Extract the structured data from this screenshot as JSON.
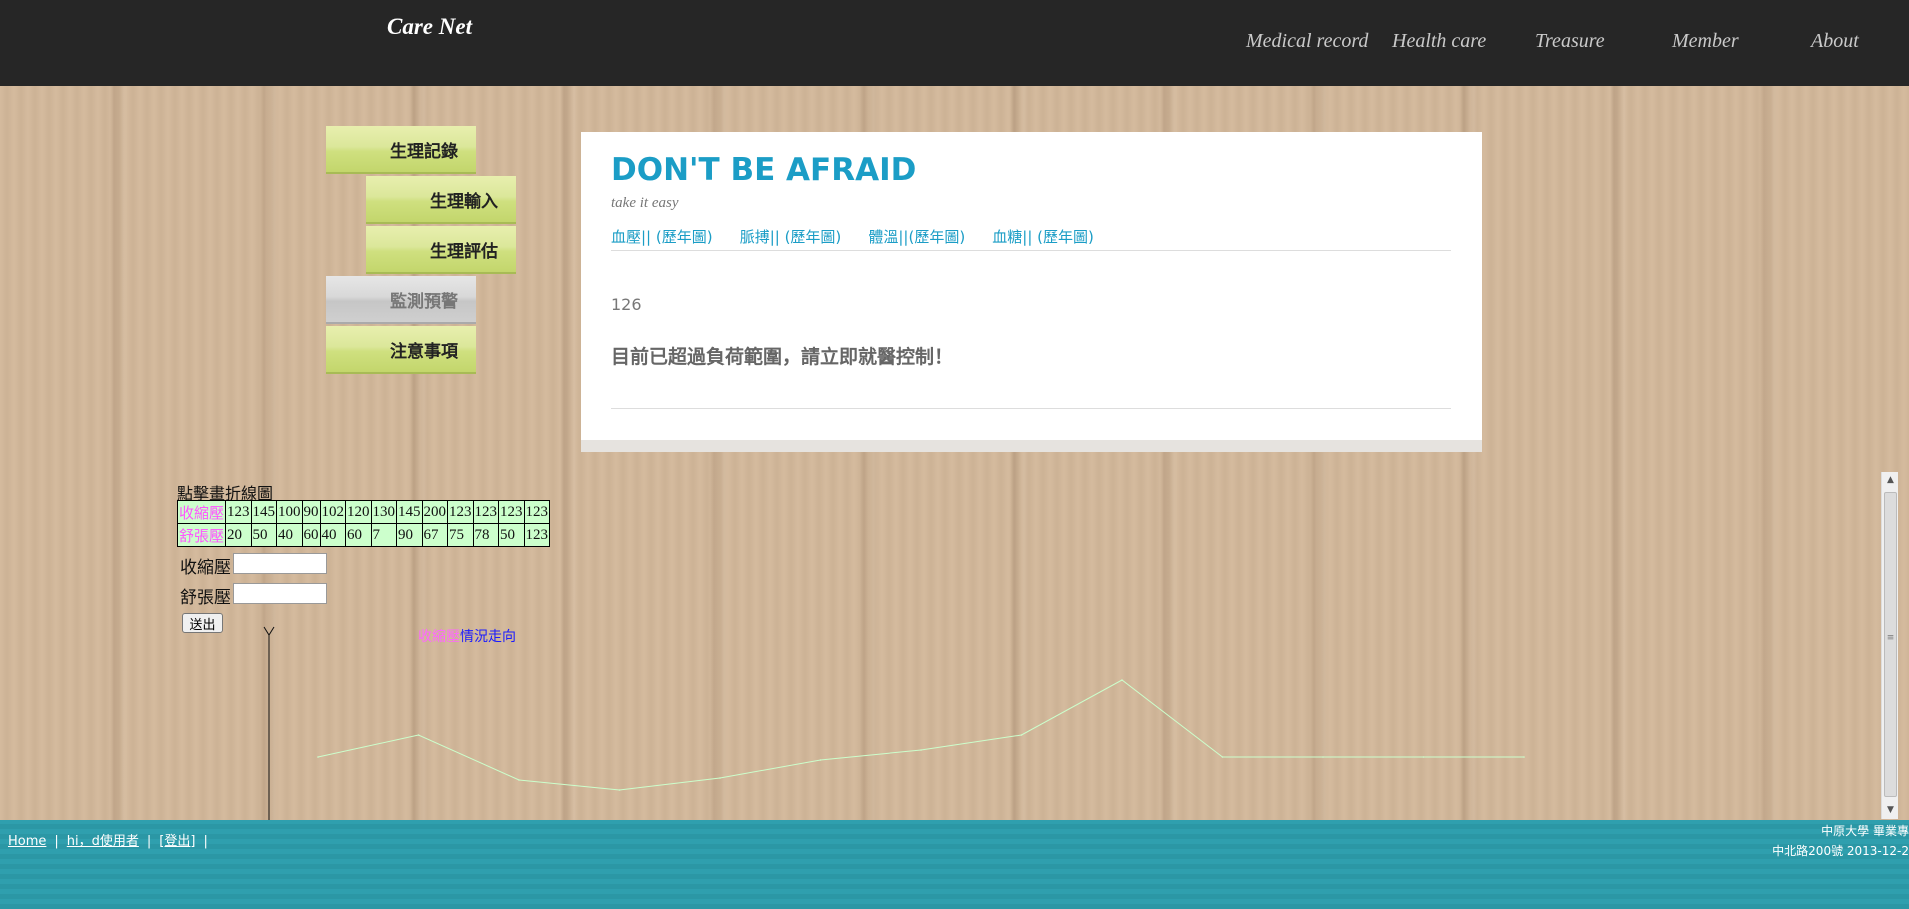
{
  "header": {
    "brand": "Care Net",
    "nav": [
      "Medical record",
      "Health care",
      "Treasure",
      "Member",
      "About"
    ]
  },
  "sidebar": {
    "items": [
      {
        "label": "生理記錄",
        "state": "active"
      },
      {
        "label": "生理輸入",
        "state": "active"
      },
      {
        "label": "生理評估",
        "state": "active"
      },
      {
        "label": "監測預警",
        "state": "disabled"
      },
      {
        "label": "注意事項",
        "state": "active"
      }
    ]
  },
  "card": {
    "title": "DON'T BE AFRAID",
    "subtitle": "take it easy",
    "links": [
      "血壓|| (歷年圖)",
      "脈搏|| (歷年圖)",
      "體溫||(歷年圖)",
      "血糖|| (歷年圖)"
    ],
    "reading": "126",
    "warning": "目前已超過負荷範圍，請立即就醫控制！"
  },
  "table": {
    "caption": "點擊畫折線圖",
    "rows": [
      {
        "label": "收縮壓",
        "values": [
          "123",
          "145",
          "100",
          "90",
          "102",
          "120",
          "130",
          "145",
          "200",
          "123",
          "123",
          "123",
          "123"
        ]
      },
      {
        "label": "舒張壓",
        "values": [
          "20",
          "50",
          "40",
          "60",
          "40",
          "60",
          "7",
          "90",
          "67",
          "75",
          "78",
          "50",
          "123"
        ]
      }
    ]
  },
  "form": {
    "systolic_label": "收縮壓",
    "diastolic_label": "舒張壓",
    "systolic_value": "",
    "diastolic_value": "",
    "submit_label": "送出"
  },
  "chart_data": {
    "type": "line",
    "title_highlight": "收縮壓",
    "title_rest": "情況走向",
    "x": [
      "1",
      "2",
      "3",
      "4",
      "5",
      "6",
      "7",
      "8",
      "9",
      "10",
      "11",
      "12",
      "13"
    ],
    "series": [
      {
        "name": "收縮壓",
        "values": [
          123,
          145,
          100,
          90,
          102,
          120,
          130,
          145,
          200,
          123,
          123,
          123,
          123
        ]
      }
    ],
    "color": "#ccffcc"
  },
  "footer": {
    "links": [
      "Home",
      "hi，d使用者",
      "[登出]"
    ],
    "right_line1": "中原大學 畢業專",
    "right_line2": "中北路200號 2013-12-2"
  }
}
